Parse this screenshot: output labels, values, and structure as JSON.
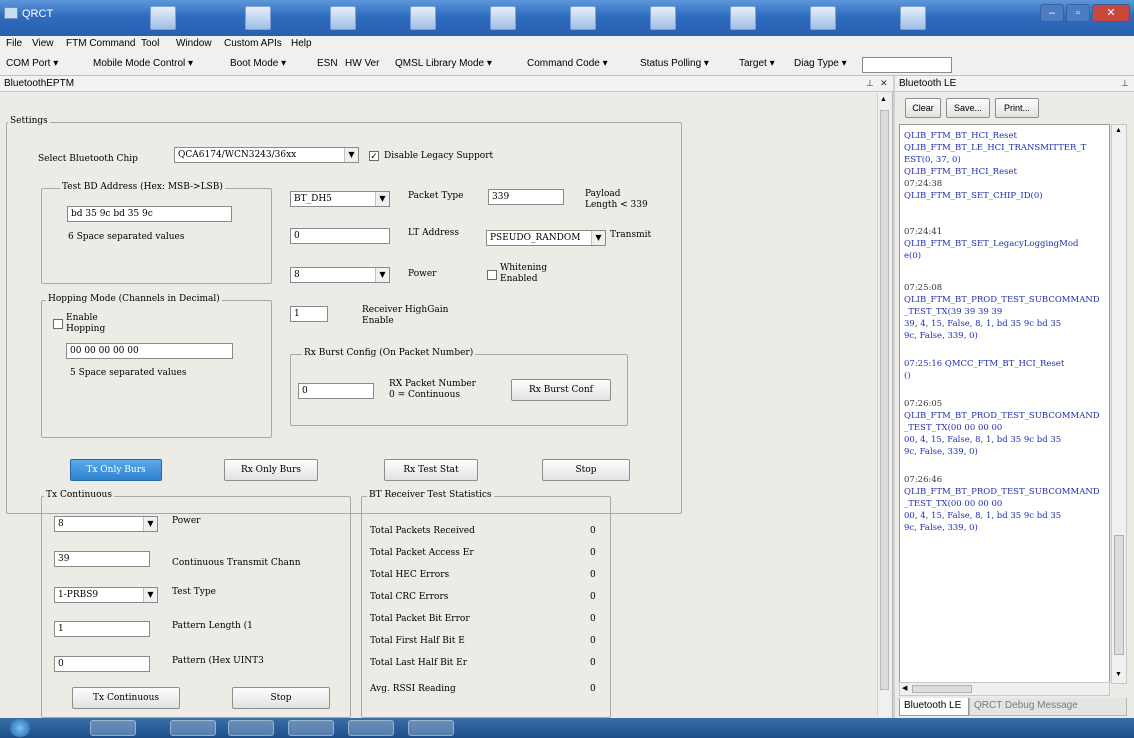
{
  "window": {
    "title": "QRCT"
  },
  "menu": [
    "File",
    "View",
    "FTM Command",
    "Tool",
    "Window",
    "Custom APIs",
    "Help"
  ],
  "toolbar": [
    "COM Port ▾",
    "Mobile Mode Control ▾",
    "Boot Mode ▾",
    "ESN",
    "HW Ver",
    "QMSL Library Mode ▾",
    "Command Code ▾",
    "Status Polling ▾",
    "Target ▾",
    "Diag Type ▾"
  ],
  "left_panel": {
    "title": "BluetoothEPTM",
    "settings": {
      "title": "Settings",
      "chip_label": "Select Bluetooth Chip",
      "chip_value": "QCA6174/WCN3243/36xx",
      "disable_legacy_label": "Disable Legacy Support",
      "disable_legacy_checked": true,
      "bd_group_title": "Test BD Address (Hex: MSB->LSB)",
      "bd_value": "bd 35 9c bd 35 9c",
      "bd_hint": "6 Space separated values",
      "packet_combo": "BT_DH5",
      "packet_type_label": "Packet Type",
      "packet_type_value": "339",
      "payload_label_1": "Payload",
      "payload_label_2": "Length < 339",
      "lt_value": "0",
      "lt_label": "LT Address",
      "pseudo_combo": "PSEUDO_RANDOM",
      "transmit_label": "Transmit",
      "power_combo": "8",
      "power_label": "Power",
      "whitening_label_1": "Whitening",
      "whitening_label_2": "Enabled",
      "hop_group_title": "Hopping Mode (Channels in Decimal)",
      "enable_hopping_label_1": "Enable",
      "enable_hopping_label_2": "Hopping",
      "hop_value": "00 00 00 00 00",
      "hop_hint": "5 Space separated values",
      "highgain_value": "1",
      "highgain_label_1": "Receiver HighGain",
      "highgain_label_2": "Enable",
      "rx_burst_title": "Rx Burst Config (On Packet Number)",
      "rx_packet_value": "0",
      "rx_packet_label_1": "RX Packet Number",
      "rx_packet_label_2": "0 = Continuous",
      "rx_burst_button": "Rx Burst Conf",
      "tx_only_button": "Tx Only Burs",
      "rx_only_button": "Rx Only Burs",
      "rx_stat_button": "Rx Test Stat",
      "stop_button": "Stop"
    },
    "tx_cont": {
      "title": "Tx Continuous",
      "power_value": "8",
      "power_label": "Power",
      "channel_value": "39",
      "channel_label": "Continuous Transmit Chann",
      "test_type_value": "1-PRBS9",
      "test_type_label": "Test Type",
      "pattern_len_value": "1",
      "pattern_len_label": "Pattern Length (1",
      "pattern_value": "0",
      "pattern_label": "Pattern (Hex UINT3",
      "start_button": "Tx Continuous",
      "stop_button": "Stop"
    },
    "stats": {
      "title": "BT Receiver Test Statistics",
      "rows": [
        {
          "label": "Total Packets Received",
          "value": "0"
        },
        {
          "label": "Total Packet Access Er",
          "value": "0"
        },
        {
          "label": "Total HEC Errors",
          "value": "0"
        },
        {
          "label": "Total CRC Errors",
          "value": "0"
        },
        {
          "label": "Total Packet Bit Error",
          "value": "0"
        },
        {
          "label": "Total First Half Bit E",
          "value": "0"
        },
        {
          "label": "Total Last Half Bit Er",
          "value": "0"
        },
        {
          "label": "Avg. RSSI Reading",
          "value": "0"
        }
      ]
    }
  },
  "right_panel": {
    "title": "Bluetooth LE",
    "buttons": [
      "Clear",
      "Save...",
      "Print..."
    ],
    "log": [
      {
        "t": "QLIB_FTM_BT_HCI_Reset",
        "ts": false
      },
      {
        "t": "QLIB_FTM_BT_LE_HCI_TRANSMITTER_T",
        "ts": false
      },
      {
        "t": "EST(0, 37, 0)",
        "ts": false
      },
      {
        "t": "QLIB_FTM_BT_HCI_Reset",
        "ts": false
      },
      {
        "t": "07:24:38",
        "ts": true
      },
      {
        "t": "QLIB_FTM_BT_SET_CHIP_ID(0)",
        "ts": false
      },
      {
        "t": "",
        "ts": true
      },
      {
        "t": "07:24:41",
        "ts": true
      },
      {
        "t": "QLIB_FTM_BT_SET_LegacyLoggingMod",
        "ts": false
      },
      {
        "t": "e(0)",
        "ts": false
      },
      {
        "t": "",
        "ts": true
      },
      {
        "t": "07:25:08",
        "ts": true
      },
      {
        "t": "QLIB_FTM_BT_PROD_TEST_SUBCOMMAND",
        "ts": false
      },
      {
        "t": "_TEST_TX(39 39 39 39",
        "ts": false
      },
      {
        "t": "39, 4, 15, False, 8, 1, bd 35 9c bd 35",
        "ts": false
      },
      {
        "t": "9c, False, 339, 0)",
        "ts": false
      },
      {
        "t": "",
        "ts": true
      },
      {
        "t": "07:25:16  QMCC_FTM_BT_HCI_Reset",
        "ts": false
      },
      {
        "t": "()",
        "ts": false
      },
      {
        "t": "",
        "ts": true
      },
      {
        "t": "07:26:05",
        "ts": true
      },
      {
        "t": "QLIB_FTM_BT_PROD_TEST_SUBCOMMAND",
        "ts": false
      },
      {
        "t": "_TEST_TX(00 00 00 00",
        "ts": false
      },
      {
        "t": "00, 4, 15, False, 8, 1, bd 35 9c bd 35",
        "ts": false
      },
      {
        "t": "9c, False, 339, 0)",
        "ts": false
      },
      {
        "t": "",
        "ts": true
      },
      {
        "t": "07:26:46",
        "ts": true
      },
      {
        "t": "QLIB_FTM_BT_PROD_TEST_SUBCOMMAND",
        "ts": false
      },
      {
        "t": "_TEST_TX(00 00 00 00",
        "ts": false
      },
      {
        "t": "00, 4, 15, False, 8, 1, bd 35 9c bd 35",
        "ts": false
      },
      {
        "t": "9c, False, 339, 0)",
        "ts": false
      }
    ],
    "tabs": [
      "Bluetooth LE",
      "QRCT Debug Message"
    ]
  }
}
